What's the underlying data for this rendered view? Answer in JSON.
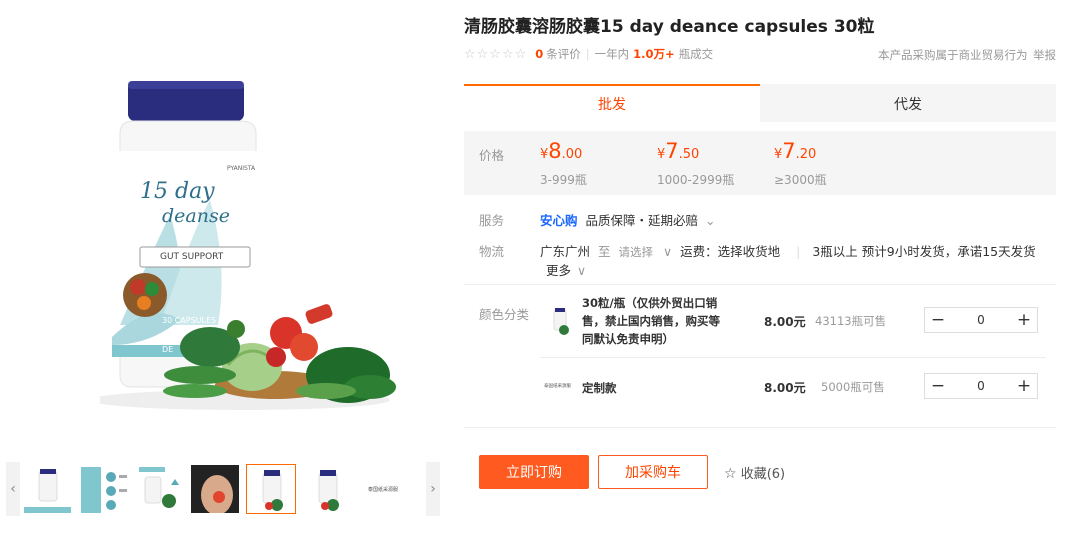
{
  "product": {
    "title": "清肠胶囊溶肠胶囊15 day deance capsules 30粒",
    "stars": "☆☆☆☆☆",
    "review_count": "0",
    "review_label": "条评价",
    "period_label": "一年内",
    "deals_count": "1.0万+",
    "deals_unit": "瓶成交",
    "trade_notice": "本产品采购属于商业贸易行为",
    "report_label": "举报"
  },
  "main_image": {
    "brand_small": "PYANISTA",
    "label_line1": "15 day",
    "label_line2": "deanse",
    "band_text": "GUT SUPPORT",
    "capsules_text": "30 CAPSULES",
    "bottom_text": "DE"
  },
  "thumbnails": {
    "prev_arrow": "‹",
    "next_arrow": "›",
    "last_thumb_text": "泰国纸采源服"
  },
  "tabs": {
    "wholesale": "批发",
    "dropship": "代发"
  },
  "pricing": {
    "label": "价格",
    "tiers": [
      {
        "symbol": "¥",
        "int": "8",
        "dec": ".00",
        "range": "3-999瓶"
      },
      {
        "symbol": "¥",
        "int": "7",
        "dec": ".50",
        "range": "1000-2999瓶"
      },
      {
        "symbol": "¥",
        "int": "7",
        "dec": ".20",
        "range": "≥3000瓶"
      }
    ]
  },
  "service": {
    "label": "服务",
    "badge": "安心购",
    "text": "品质保障・延期必赔",
    "chevron": "⌄"
  },
  "logistics": {
    "label": "物流",
    "origin": "广东广州",
    "to": "至",
    "select": "请选择",
    "chevron": "∨",
    "fee": "运费：选择收货地",
    "delivery": "3瓶以上 预计9小时发货，承诺15天发货",
    "more": "更多"
  },
  "sku": {
    "label": "颜色分类",
    "items": [
      {
        "name": "30粒/瓶（仅供外贸出口销售，禁止国内销售，购买等同默认免责申明）",
        "price": "8.00元",
        "stock": "43113瓶可售",
        "qty": "0"
      },
      {
        "thumb_text": "泰国纸采源服",
        "name": "定制款",
        "price": "8.00元",
        "stock": "5000瓶可售",
        "qty": "0"
      }
    ],
    "minus": "−",
    "plus": "+"
  },
  "actions": {
    "buy_now": "立即订购",
    "add_cart": "加采购车",
    "favorite_icon": "☆",
    "favorite": "收藏(6)"
  },
  "colors": {
    "accent": "#ff4400",
    "button_orange": "#ff5a1f",
    "service_blue": "#1a66ff",
    "bottle_cap": "#2a2d7e",
    "label_teal": "#7fc6cf"
  }
}
